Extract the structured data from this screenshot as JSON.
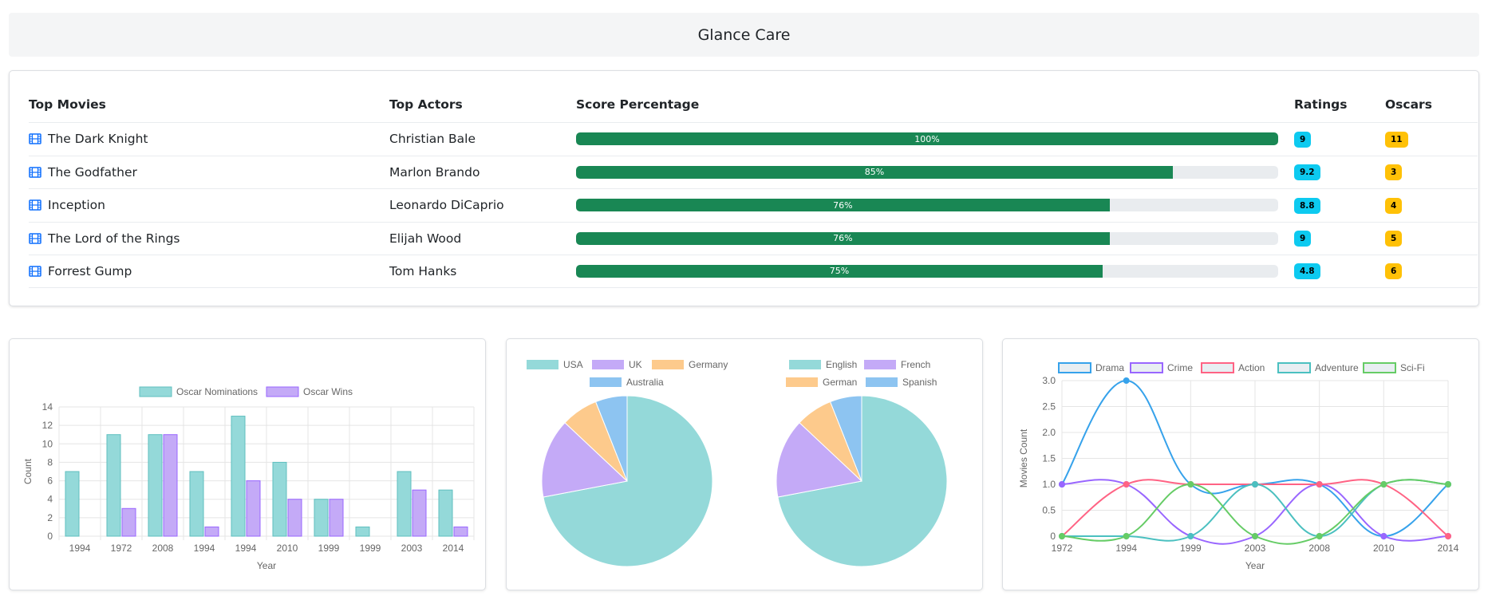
{
  "app": {
    "title": "Glance Care"
  },
  "table": {
    "headers": {
      "movies": "Top Movies",
      "actors": "Top Actors",
      "score": "Score Percentage",
      "ratings": "Ratings",
      "oscars": "Oscars"
    },
    "rows": [
      {
        "movie": "The Dark Knight",
        "actor": "Christian Bale",
        "score": 100,
        "score_label": "100%",
        "rating": "9",
        "oscars": "11"
      },
      {
        "movie": "The Godfather",
        "actor": "Marlon Brando",
        "score": 85,
        "score_label": "85%",
        "rating": "9.2",
        "oscars": "3"
      },
      {
        "movie": "Inception",
        "actor": "Leonardo DiCaprio",
        "score": 76,
        "score_label": "76%",
        "rating": "8.8",
        "oscars": "4"
      },
      {
        "movie": "The Lord of the Rings",
        "actor": "Elijah Wood",
        "score": 76,
        "score_label": "76%",
        "rating": "9",
        "oscars": "5"
      },
      {
        "movie": "Forrest Gump",
        "actor": "Tom Hanks",
        "score": 75,
        "score_label": "75%",
        "rating": "4.8",
        "oscars": "6"
      }
    ],
    "row_icon": "film-icon",
    "colors": {
      "progress": "#198754",
      "rating_badge": "#0dcaf0",
      "oscar_badge": "#ffc107",
      "icon": "#0d6efd"
    }
  },
  "chart_data": [
    {
      "type": "bar",
      "categories": [
        "1994",
        "1972",
        "2008",
        "1994",
        "1994",
        "2010",
        "1999",
        "1999",
        "2003",
        "2014"
      ],
      "series": [
        {
          "name": "Oscar Nominations",
          "values": [
            7,
            11,
            11,
            7,
            13,
            8,
            4,
            1,
            7,
            5
          ],
          "color": "#94d9d9"
        },
        {
          "name": "Oscar Wins",
          "values": [
            0,
            3,
            11,
            1,
            6,
            4,
            4,
            0,
            5,
            1
          ],
          "color": "#c4aaf7"
        }
      ],
      "xlabel": "Year",
      "ylabel": "Count",
      "ylim": [
        0,
        14
      ],
      "yticks": [
        0,
        2,
        4,
        6,
        8,
        10,
        12,
        14
      ],
      "grid": true,
      "legend": "top"
    },
    {
      "type": "pie",
      "labels": [
        "USA",
        "UK",
        "Germany",
        "Australia"
      ],
      "values": [
        72,
        15,
        7,
        6
      ],
      "colors": [
        "#94d9d9",
        "#c4aaf7",
        "#fdca8c",
        "#8dc4f1"
      ],
      "legend": "top"
    },
    {
      "type": "pie",
      "labels": [
        "English",
        "French",
        "German",
        "Spanish"
      ],
      "values": [
        72,
        15,
        7,
        6
      ],
      "colors": [
        "#94d9d9",
        "#c4aaf7",
        "#fdca8c",
        "#8dc4f1"
      ],
      "legend": "top"
    },
    {
      "type": "line",
      "x": [
        "1972",
        "1994",
        "1999",
        "2003",
        "2008",
        "2010",
        "2014"
      ],
      "series": [
        {
          "name": "Drama",
          "values": [
            1,
            3,
            1,
            1,
            1,
            0,
            1
          ],
          "color": "#36a2eb"
        },
        {
          "name": "Crime",
          "values": [
            1,
            1,
            0,
            0,
            1,
            0,
            0
          ],
          "color": "#9966ff"
        },
        {
          "name": "Action",
          "values": [
            0,
            1,
            1,
            1,
            1,
            1,
            0
          ],
          "color": "#ff6384"
        },
        {
          "name": "Adventure",
          "values": [
            0,
            0,
            0,
            1,
            0,
            1,
            1
          ],
          "color": "#4bc0c0"
        },
        {
          "name": "Sci-Fi",
          "values": [
            0,
            0,
            1,
            0,
            0,
            1,
            1
          ],
          "color": "#66cc66"
        }
      ],
      "xlabel": "Year",
      "ylabel": "Movies Count",
      "ylim": [
        0,
        3
      ],
      "yticks": [
        "0",
        "0.5",
        "1.0",
        "1.5",
        "2.0",
        "2.5",
        "3.0"
      ],
      "grid": true,
      "legend": "top"
    }
  ]
}
